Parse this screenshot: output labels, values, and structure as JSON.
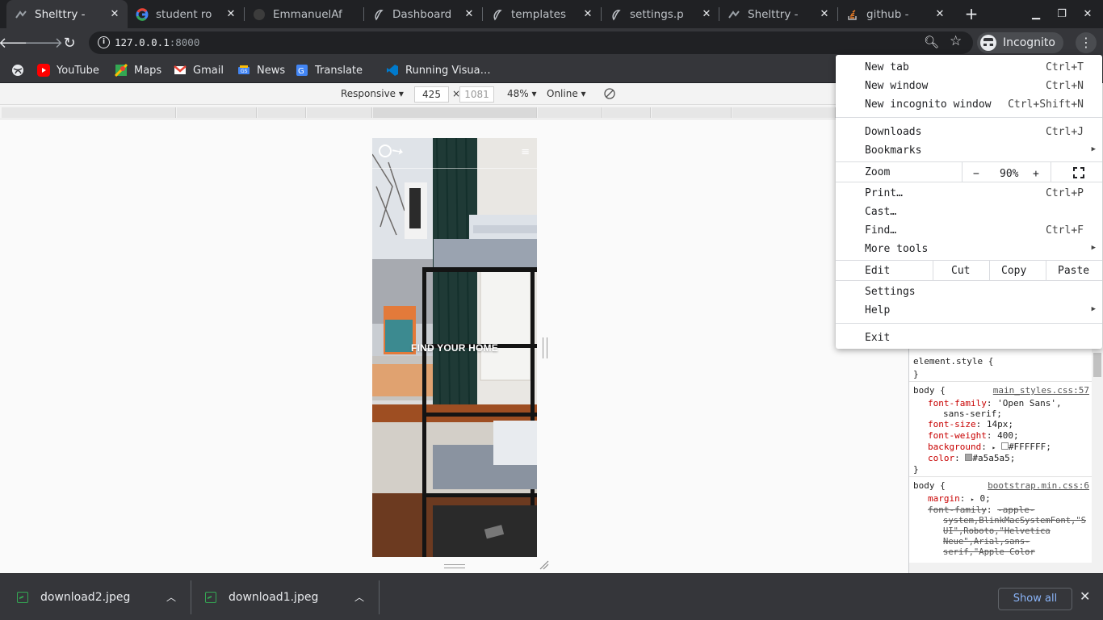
{
  "tabs": [
    {
      "title": "Shelttry - ",
      "icon": "shelttry-icon",
      "active": true
    },
    {
      "title": "student ro",
      "icon": "google-icon"
    },
    {
      "title": "EmmanuelAf",
      "icon": "github-icon"
    },
    {
      "title": "Dashboard",
      "icon": "django-icon"
    },
    {
      "title": "templates",
      "icon": "django-icon"
    },
    {
      "title": "settings.p",
      "icon": "django-icon"
    },
    {
      "title": "Shelttry - ",
      "icon": "shelttry-icon"
    },
    {
      "title": "github - ",
      "icon": "stackoverflow-icon"
    }
  ],
  "toolbar": {
    "url_host": "127.0.0.1",
    "url_port": ":8000",
    "incognito_label": "Incognito"
  },
  "bookmarks": [
    {
      "label": "YouTube",
      "icon": "youtube-icon",
      "color": "#ff0000"
    },
    {
      "label": "Maps",
      "icon": "maps-icon",
      "color": "#34a853"
    },
    {
      "label": "Gmail",
      "icon": "gmail-icon",
      "color": "#ea4335"
    },
    {
      "label": "News",
      "icon": "news-icon",
      "color": "#4285f4"
    },
    {
      "label": "Translate",
      "icon": "translate-icon",
      "color": "#4285f4"
    },
    {
      "label": "Running Visua…",
      "icon": "vscode-icon",
      "color": "#007acc"
    }
  ],
  "device_toolbar": {
    "mode": "Responsive",
    "width": "425",
    "height": "1081",
    "times": "×",
    "zoom": "48%",
    "network": "Online"
  },
  "device_page": {
    "hero_text": "FIND YOUR HOME"
  },
  "devtools": {
    "element_style": "element.style {",
    "close_brace": "}",
    "rule1": {
      "selector": "body {",
      "source": "main_styles.css:57",
      "props": [
        {
          "name": "font-family",
          "value": "'Open Sans',"
        },
        {
          "name": "",
          "value": "sans-serif;"
        },
        {
          "name": "font-size",
          "value": "14px;"
        },
        {
          "name": "font-weight",
          "value": "400;"
        },
        {
          "name": "background",
          "value": "#FFFFFF;"
        },
        {
          "name": "color",
          "value": "#a5a5a5;"
        }
      ]
    },
    "rule2": {
      "selector": "body {",
      "source": "bootstrap.min.css:6",
      "margin": "0;",
      "font_family_lines": [
        "-apple-",
        "system,BlinkMacSystemFont,\"S",
        "UI\",Roboto,\"Helvetica",
        "Neue\",Arial,sans-",
        "serif,\"Apple Color"
      ]
    }
  },
  "downloads": [
    {
      "name": "download2.jpeg"
    },
    {
      "name": "download1.jpeg"
    }
  ],
  "shelf": {
    "show_all": "Show all"
  },
  "menu": {
    "new_tab": {
      "label": "New tab",
      "shortcut": "Ctrl+T"
    },
    "new_window": {
      "label": "New window",
      "shortcut": "Ctrl+N"
    },
    "new_incognito": {
      "label": "New incognito window",
      "shortcut": "Ctrl+Shift+N"
    },
    "downloads": {
      "label": "Downloads",
      "shortcut": "Ctrl+J"
    },
    "bookmarks": {
      "label": "Bookmarks"
    },
    "zoom": {
      "label": "Zoom",
      "minus": "−",
      "value": "90%",
      "plus": "+"
    },
    "print": {
      "label": "Print…",
      "shortcut": "Ctrl+P"
    },
    "cast": {
      "label": "Cast…"
    },
    "find": {
      "label": "Find…",
      "shortcut": "Ctrl+F"
    },
    "more_tools": {
      "label": "More tools"
    },
    "edit": {
      "label": "Edit",
      "cut": "Cut",
      "copy": "Copy",
      "paste": "Paste"
    },
    "settings": {
      "label": "Settings"
    },
    "help": {
      "label": "Help"
    },
    "exit": {
      "label": "Exit"
    }
  }
}
